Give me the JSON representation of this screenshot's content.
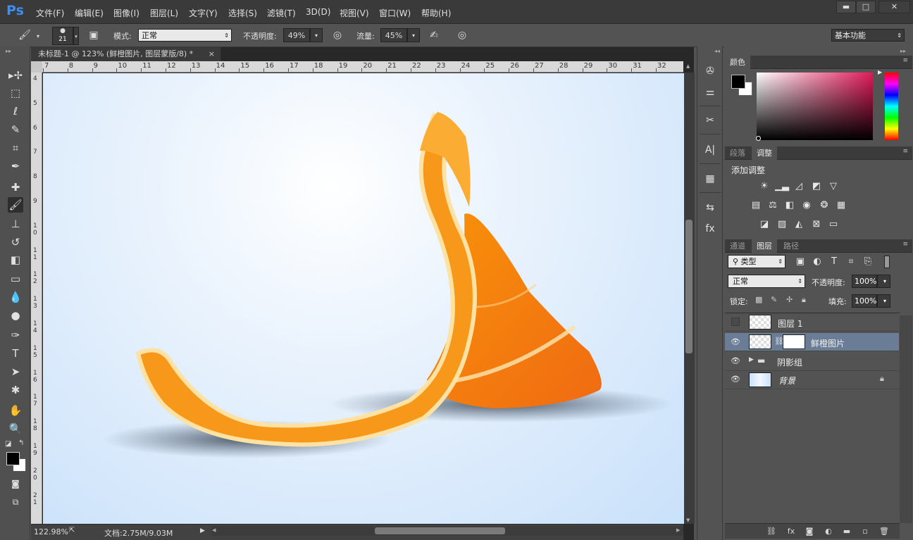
{
  "app": {
    "logo": "Ps"
  },
  "menu": [
    "文件(F)",
    "编辑(E)",
    "图像(I)",
    "图层(L)",
    "文字(Y)",
    "选择(S)",
    "滤镜(T)",
    "3D(D)",
    "视图(V)",
    "窗口(W)",
    "帮助(H)"
  ],
  "window_controls": {
    "minimize": "▬",
    "maximize": "□",
    "close": "✕"
  },
  "options": {
    "brush_size": "21",
    "mode_label": "模式:",
    "mode_value": "正常",
    "opacity_label": "不透明度:",
    "opacity_value": "49%",
    "flow_label": "流量:",
    "flow_value": "45%",
    "workspace": "基本功能"
  },
  "document": {
    "tab_title": "未标题-1 @ 123% (鲜橙图片, 图层蒙版/8) *",
    "tab_close": "×",
    "zoom": "122.98%",
    "doc_info": "文档:2.75M/9.03M"
  },
  "rulers": {
    "h": [
      "7",
      "8",
      "9",
      "10",
      "11",
      "12",
      "13",
      "14",
      "15",
      "16",
      "17",
      "18",
      "19",
      "20",
      "21",
      "22",
      "23",
      "24",
      "25",
      "26",
      "27",
      "28",
      "29",
      "30",
      "31",
      "32"
    ],
    "v": [
      "4",
      "5",
      "6",
      "7",
      "8",
      "9",
      "1\n0",
      "1\n1",
      "1\n2",
      "1\n3",
      "1\n4",
      "1\n5",
      "1\n6",
      "1\n7",
      "1\n8",
      "1\n9",
      "2\n0",
      "2\n1"
    ]
  },
  "tools": [
    {
      "name": "move-tool",
      "glyph": "▸✢"
    },
    {
      "name": "marquee-tool",
      "glyph": "⬚"
    },
    {
      "name": "lasso-tool",
      "glyph": "ℓ"
    },
    {
      "name": "quick-select-tool",
      "glyph": "✎"
    },
    {
      "name": "crop-tool",
      "glyph": "⌗"
    },
    {
      "name": "eyedropper-tool",
      "glyph": "✒"
    },
    {
      "name": "healing-brush-tool",
      "glyph": "✚"
    },
    {
      "name": "brush-tool",
      "glyph": "🖌"
    },
    {
      "name": "clone-stamp-tool",
      "glyph": "⊥"
    },
    {
      "name": "history-brush-tool",
      "glyph": "↺"
    },
    {
      "name": "eraser-tool",
      "glyph": "◧"
    },
    {
      "name": "gradient-tool",
      "glyph": "▭"
    },
    {
      "name": "blur-tool",
      "glyph": "💧"
    },
    {
      "name": "dodge-tool",
      "glyph": "●"
    },
    {
      "name": "pen-tool",
      "glyph": "✑"
    },
    {
      "name": "type-tool",
      "glyph": "T"
    },
    {
      "name": "path-select-tool",
      "glyph": "➤"
    },
    {
      "name": "shape-tool",
      "glyph": "✱"
    },
    {
      "name": "hand-tool",
      "glyph": "✋"
    },
    {
      "name": "zoom-tool",
      "glyph": "🔍"
    }
  ],
  "panels": {
    "color_tab": "颜色",
    "paragraph_tab": "段落",
    "adjust_tab": "调整",
    "add_adjust": "添加调整",
    "channels_tab": "通道",
    "layers_tab": "图层",
    "paths_tab": "路径"
  },
  "layers_panel": {
    "filter_kind": "类型",
    "blend_mode": "正常",
    "opacity_label": "不透明度:",
    "opacity_value": "100%",
    "lock_label": "锁定:",
    "fill_label": "填充:",
    "fill_value": "100%",
    "layers": [
      {
        "name": "图层 1",
        "visible": false
      },
      {
        "name": "鲜橙图片",
        "visible": true,
        "selected": true
      },
      {
        "name": "阴影组",
        "visible": true
      },
      {
        "name": "背景",
        "visible": true
      }
    ]
  },
  "colors": {
    "menubar": "#3a3a3a",
    "panel": "#535353",
    "selected_layer": "#6a7c96",
    "accent_logo": "#3d8ef0",
    "orange": "#f57f1b"
  }
}
